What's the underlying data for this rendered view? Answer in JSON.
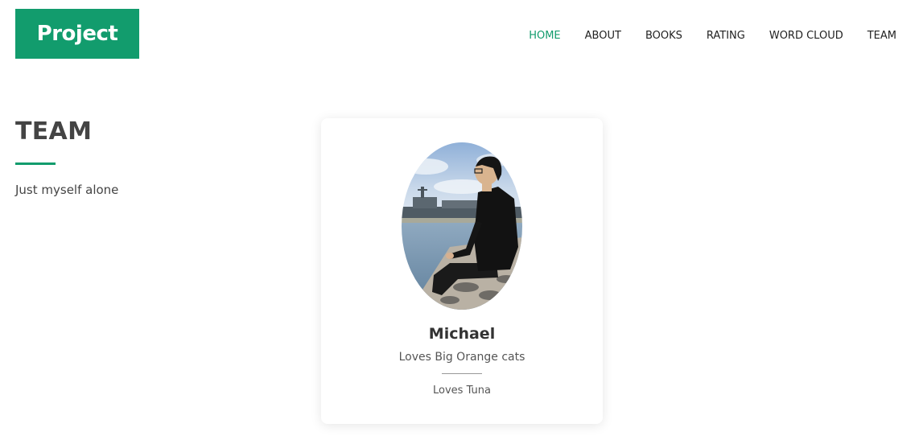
{
  "header": {
    "logo_text": "Project",
    "brand_color": "#129c6d",
    "nav": [
      {
        "label": "HOME",
        "active": true
      },
      {
        "label": "ABOUT",
        "active": false
      },
      {
        "label": "BOOKS",
        "active": false
      },
      {
        "label": "RATING",
        "active": false
      },
      {
        "label": "WORD CLOUD",
        "active": false
      },
      {
        "label": "TEAM",
        "active": false
      }
    ]
  },
  "team_section": {
    "title": "TEAM",
    "description": "Just myself alone"
  },
  "member": {
    "name": "Michael",
    "bio": "Loves Big Orange cats",
    "note": "Loves Tuna",
    "photo_icon": "member-photo"
  }
}
